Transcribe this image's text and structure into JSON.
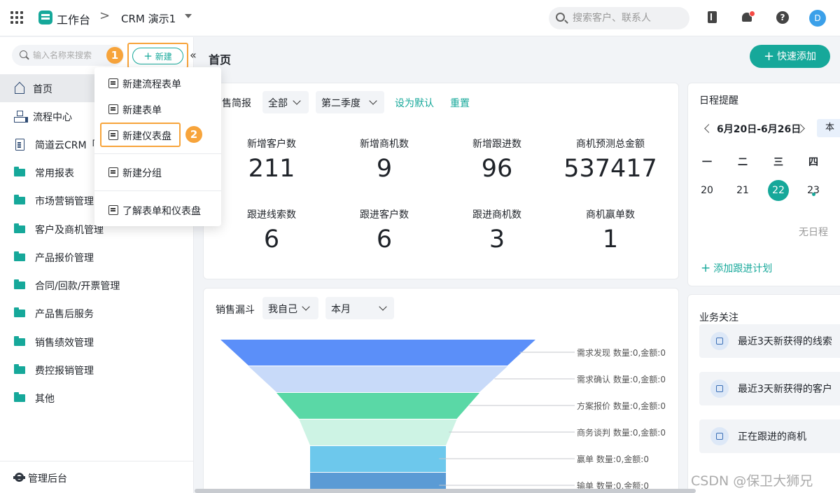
{
  "topbar": {
    "app_name": "工作台",
    "crumb_sep": ">",
    "crm_name": "CRM 演示1",
    "search_placeholder": "搜索客户、联系人",
    "avatar": "D"
  },
  "sidebar": {
    "search_placeholder": "输入名称来搜索",
    "new_label": "新建",
    "collapse": "«",
    "items": [
      {
        "label": "首页",
        "icon": "home-icon"
      },
      {
        "label": "流程中心",
        "icon": "flow-icon"
      },
      {
        "label": "简道云CRM「",
        "icon": "doc-icon"
      },
      {
        "label": "常用报表",
        "icon": "folder-icon"
      },
      {
        "label": "市场营销管理",
        "icon": "folder-icon"
      },
      {
        "label": "客户及商机管理",
        "icon": "folder-icon"
      },
      {
        "label": "产品报价管理",
        "icon": "folder-icon"
      },
      {
        "label": "合同/回款/开票管理",
        "icon": "folder-icon"
      },
      {
        "label": "产品售后服务",
        "icon": "folder-icon"
      },
      {
        "label": "销售绩效管理",
        "icon": "folder-icon"
      },
      {
        "label": "费控报销管理",
        "icon": "folder-icon"
      },
      {
        "label": "其他",
        "icon": "folder-icon"
      }
    ],
    "footer": "管理后台"
  },
  "badges": {
    "one": "1",
    "two": "2"
  },
  "popup": {
    "items": [
      "新建流程表单",
      "新建表单",
      "新建仪表盘",
      "新建分组",
      "了解表单和仪表盘"
    ]
  },
  "main": {
    "title": "首页",
    "quick_add": "快速添加"
  },
  "sales_brief": {
    "title": "销售简报",
    "filter1": "全部",
    "filter2": "第二季度",
    "set_default": "设为默认",
    "reset": "重置",
    "stats": [
      {
        "label": "新增客户数",
        "value": "211"
      },
      {
        "label": "新增商机数",
        "value": "9"
      },
      {
        "label": "新增跟进数",
        "value": "96"
      },
      {
        "label": "商机预测总金额",
        "value": "537417"
      },
      {
        "label": "跟进线索数",
        "value": "6"
      },
      {
        "label": "跟进客户数",
        "value": "6"
      },
      {
        "label": "跟进商机数",
        "value": "3"
      },
      {
        "label": "商机赢单数",
        "value": "1"
      }
    ]
  },
  "funnel": {
    "title": "销售漏斗",
    "filter1": "我自己",
    "filter2": "本月",
    "colors": [
      "#5b8ff9",
      "#c8daf9",
      "#5ad8a6",
      "#cdf3e4",
      "#6dc8ec",
      "#5b9bd5"
    ],
    "stages": [
      {
        "label": "需求发现 数量:0,金额:0"
      },
      {
        "label": "需求确认 数量:0,金额:0"
      },
      {
        "label": "方案报价 数量:0,金额:0"
      },
      {
        "label": "商务谈判 数量:0,金额:0"
      },
      {
        "label": "赢单 数量:0,金额:0"
      },
      {
        "label": "输单 数量:0,金额:0"
      }
    ]
  },
  "schedule": {
    "title": "日程提醒",
    "week_range": "6月20日-6月26日",
    "this_week": "本",
    "weekdays": [
      "一",
      "二",
      "三",
      "四"
    ],
    "days": [
      "20",
      "21",
      "22",
      "23"
    ],
    "empty": "无日程",
    "add_plan": "添加跟进计划"
  },
  "focus": {
    "title": "业务关注",
    "items": [
      "最近3天新获得的线索",
      "最近3天新获得的客户",
      "正在跟进的商机"
    ]
  },
  "watermark": "CSDN @保卫大狮兄"
}
